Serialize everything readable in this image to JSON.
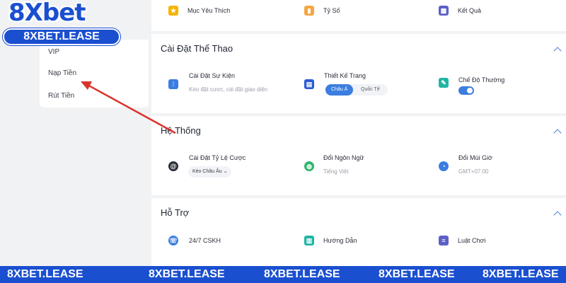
{
  "logo": {
    "wordmark": "8Xbet",
    "domain": "8XBET.LEASE"
  },
  "sidebar": {
    "items": [
      {
        "label": "VIP"
      },
      {
        "label": "Nạp Tiền"
      },
      {
        "label": "Rút Tiền"
      }
    ]
  },
  "top_row": [
    {
      "label": "Mục Yêu Thích",
      "icon": "star-icon",
      "color": "#f4b400"
    },
    {
      "label": "Tỷ Số",
      "icon": "chart-bar-icon",
      "color": "#f4a742"
    },
    {
      "label": "Kết Quả",
      "icon": "grid-icon",
      "color": "#5b5fc7"
    }
  ],
  "sports_settings": {
    "title": "Cài Đặt Thể Thao",
    "event_settings": {
      "label": "Cài Đặt Sự Kiện",
      "sub": "Kéo đặt cược, cài đặt giao diện",
      "icon": "sliders-icon",
      "color": "#3b7de0"
    },
    "page_design": {
      "label": "Thiết Kế Trang",
      "options": [
        "Châu Á",
        "Quốc Tế"
      ],
      "selected": "Châu Á",
      "icon": "layout-icon",
      "color": "#2a5bd7"
    },
    "normal_mode": {
      "label": "Chế Độ Thường",
      "enabled": true,
      "icon": "wrench-icon",
      "color": "#1fb5a5"
    }
  },
  "system": {
    "title": "Hệ Thống",
    "odds": {
      "label": "Cài Đặt Tỷ Lệ Cược",
      "value": "Kéo Châu Âu",
      "icon": "at-icon",
      "color": "#2b2f3a"
    },
    "language": {
      "label": "Đổi Ngôn Ngữ",
      "value": "Tiếng Việt",
      "icon": "globe-icon",
      "color": "#2fb46a"
    },
    "timezone": {
      "label": "Đổi Múi Giờ",
      "value": "GMT+07:00",
      "icon": "clock-icon",
      "color": "#3b7de0"
    }
  },
  "support": {
    "title": "Hỗ Trợ",
    "items": [
      {
        "label": "24/7 CSKH",
        "icon": "chat-icon",
        "color": "#3b7de0"
      },
      {
        "label": "Hướng Dẫn",
        "icon": "book-icon",
        "color": "#1fb5a5"
      },
      {
        "label": "Luật Chơi",
        "icon": "document-icon",
        "color": "#5b5fc7"
      }
    ]
  },
  "footer": {
    "watermarks": [
      "8XBET.LEASE",
      "8XBET.LEASE",
      "8XBET.LEASE",
      "8XBET.LEASE",
      "8XBET.LEASE"
    ]
  },
  "annotation": {
    "color": "#d9342b",
    "points_to": "Nạp Tiền"
  }
}
